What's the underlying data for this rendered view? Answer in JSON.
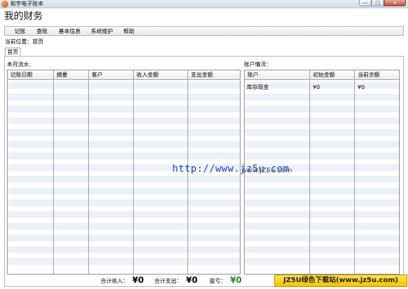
{
  "window": {
    "title": "和宇电子账本",
    "buttons": {
      "minimize": "—",
      "maximize": "□",
      "close": "×"
    }
  },
  "app_title": "我的财务",
  "menu": [
    "记账",
    "查账",
    "基本信息",
    "系统维护",
    "帮助"
  ],
  "breadcrumb": "当前位置：首页",
  "tab": "首页",
  "ledger": {
    "label": "本月流水:",
    "columns": [
      "记账日期",
      "摘要",
      "客户",
      "收入金额",
      "支出金额"
    ],
    "rows": []
  },
  "accounts": {
    "label": "账户情况：",
    "columns": [
      "账户",
      "初始金额",
      "当前余额"
    ],
    "rows": [
      {
        "account": "库存现金",
        "initial": "¥0",
        "current": "¥0"
      }
    ]
  },
  "totals": {
    "income_label": "合计收入：",
    "income_value": "¥0",
    "expense_label": "合计支出：",
    "expense_value": "¥0",
    "profit_label": "盈亏：",
    "profit_value": "¥0"
  },
  "watermark": {
    "url": "http://www.jz5u.com",
    "overlay_text": "www.JZ5u.com"
  },
  "badge": "JZ5U绿色下载站(www.jz5u.com)",
  "colors": {
    "profit": "#1e8a22",
    "watermark": "#1f3fd8",
    "row_stripe": "#ecf1f8",
    "badge": "#f7c400"
  }
}
